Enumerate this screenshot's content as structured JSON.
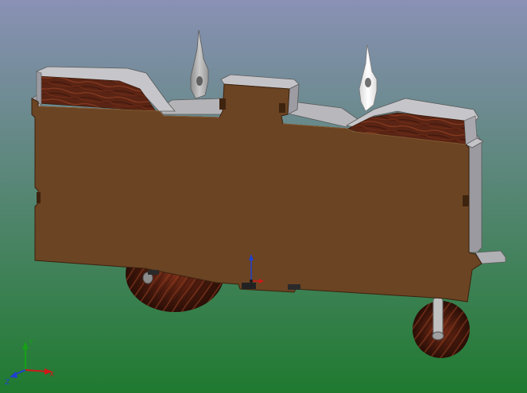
{
  "viewport": {
    "background_top": "#8a91b5",
    "background_bottom": "#1f7a2f"
  },
  "colors": {
    "part_side": "#6b4423",
    "part_edge": "#3a220f",
    "top_face": "#b9b9bd",
    "top_face_dark": "#8d8d92",
    "wood_dark": "#4a1e10",
    "wood_mid": "#7a3520",
    "pointer_dark": "#9a9a9a",
    "pointer_light": "#e6e6e6",
    "origin_x": "#d01818",
    "origin_y": "#18a018",
    "origin_z": "#2040d0"
  },
  "icons": {
    "origin_triad": "origin-triad-icon",
    "axis_triad": "axis-triad-icon"
  }
}
